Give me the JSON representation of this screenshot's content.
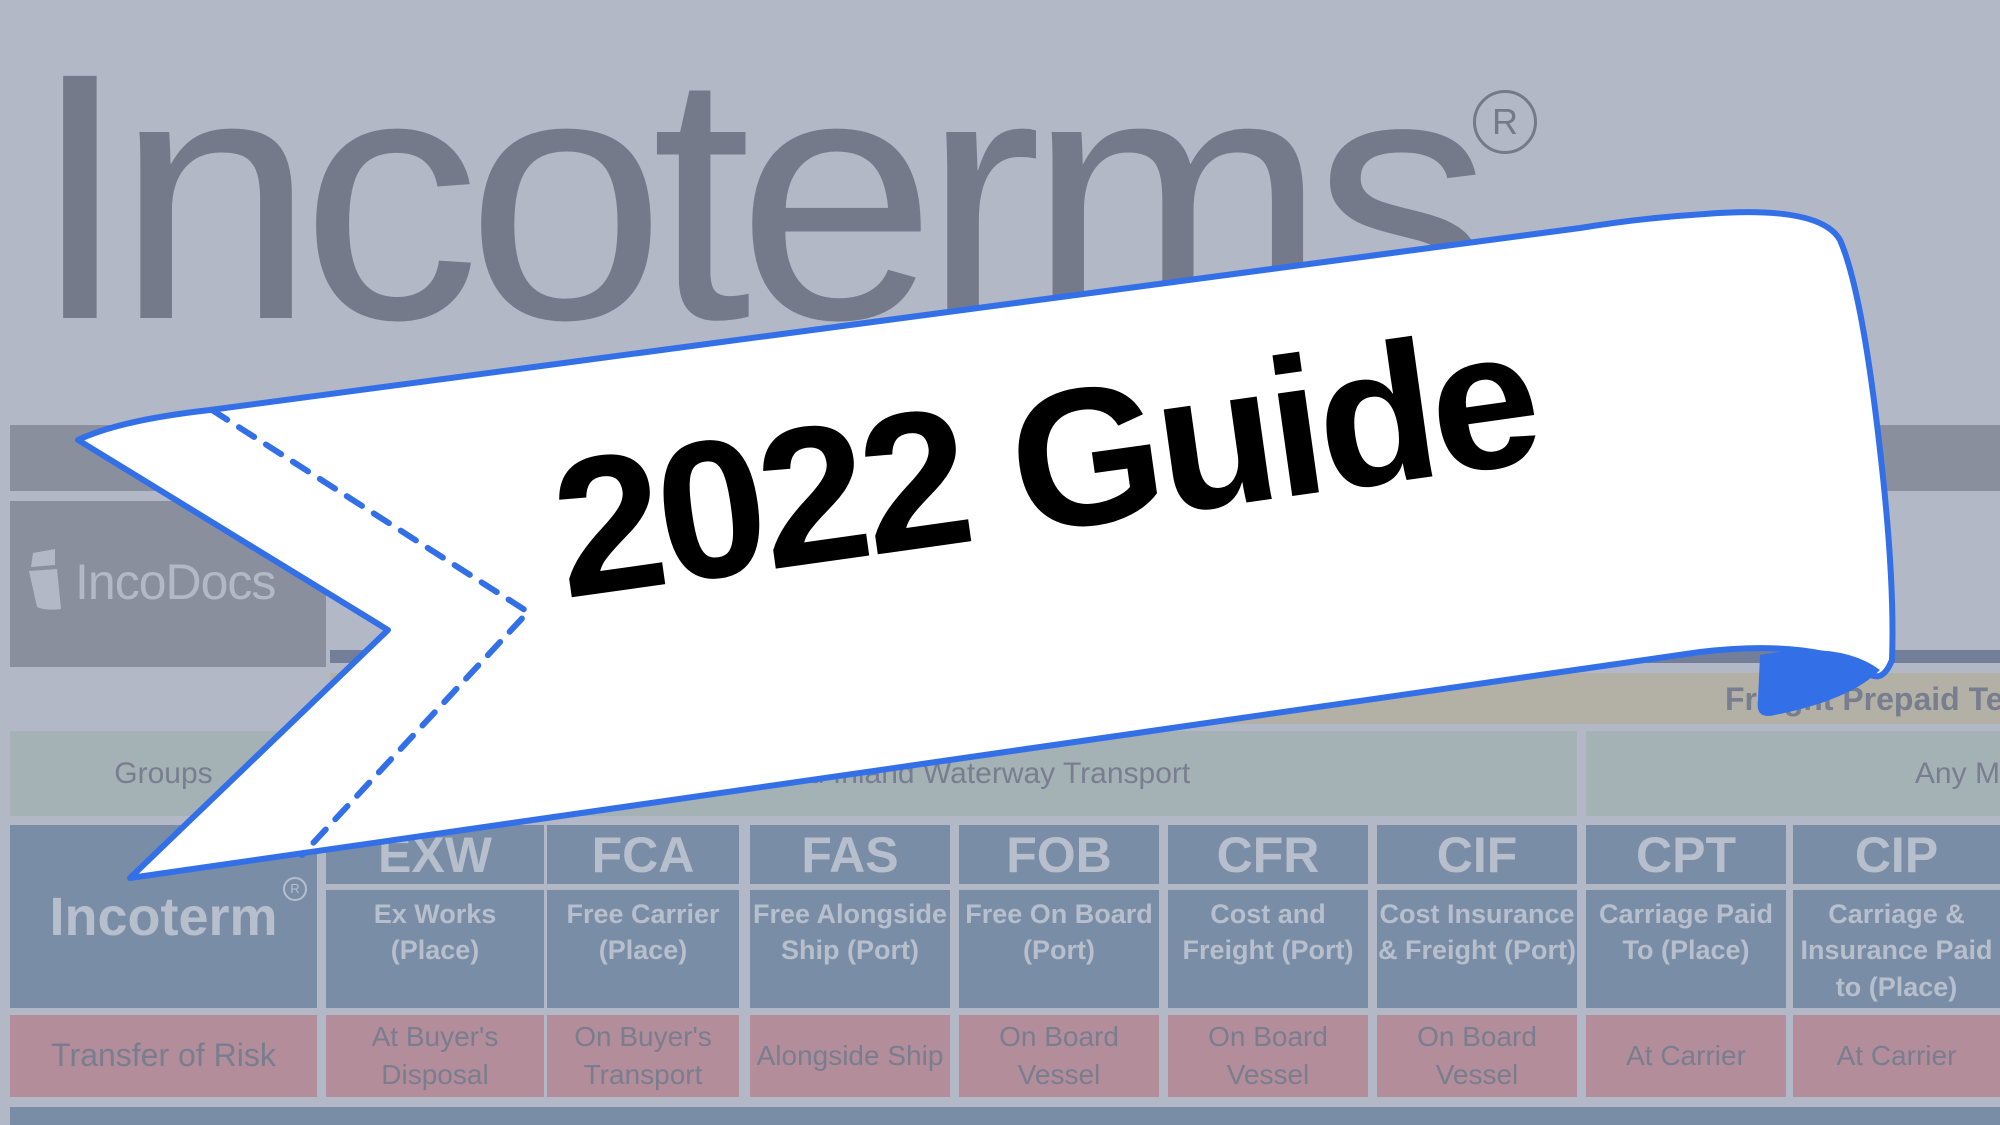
{
  "headline": {
    "title": "Incoterms",
    "registered_mark": "R",
    "year_partial": "20"
  },
  "logo": {
    "text": "IncoDocs",
    "icon": "incodocs-logo-icon"
  },
  "freight_bar": {
    "label": "Freight Prepaid Terms"
  },
  "table": {
    "groups_label": "Groups",
    "group_sea": "Sea and Inland Waterway Transport",
    "group_any": "Any Mode",
    "incoterm_label": "Incoterm",
    "incoterm_reg": "R",
    "risk_label": "Transfer of Risk",
    "terms": [
      {
        "code": "EXW",
        "desc": "Ex Works (Place)",
        "risk": "At Buyer's Disposal"
      },
      {
        "code": "FCA",
        "desc": "Free Carrier (Place)",
        "risk": "On Buyer's Transport"
      },
      {
        "code": "FAS",
        "desc": "Free Alongside Ship (Port)",
        "risk": "Alongside Ship"
      },
      {
        "code": "FOB",
        "desc": "Free On Board (Port)",
        "risk": "On Board Vessel"
      },
      {
        "code": "CFR",
        "desc": "Cost and Freight (Port)",
        "risk": "On Board Vessel"
      },
      {
        "code": "CIF",
        "desc": "Cost Insurance & Freight (Port)",
        "risk": "On Board Vessel"
      },
      {
        "code": "CPT",
        "desc": "Carriage Paid To (Place)",
        "risk": "At Carrier"
      },
      {
        "code": "CIP",
        "desc": "Carriage & Insurance Paid to (Place)",
        "risk": "At Carrier"
      }
    ]
  },
  "ribbon": {
    "text": "2022 Guide",
    "accent_color": "#3370e8",
    "fill_color": "#ffffff"
  }
}
